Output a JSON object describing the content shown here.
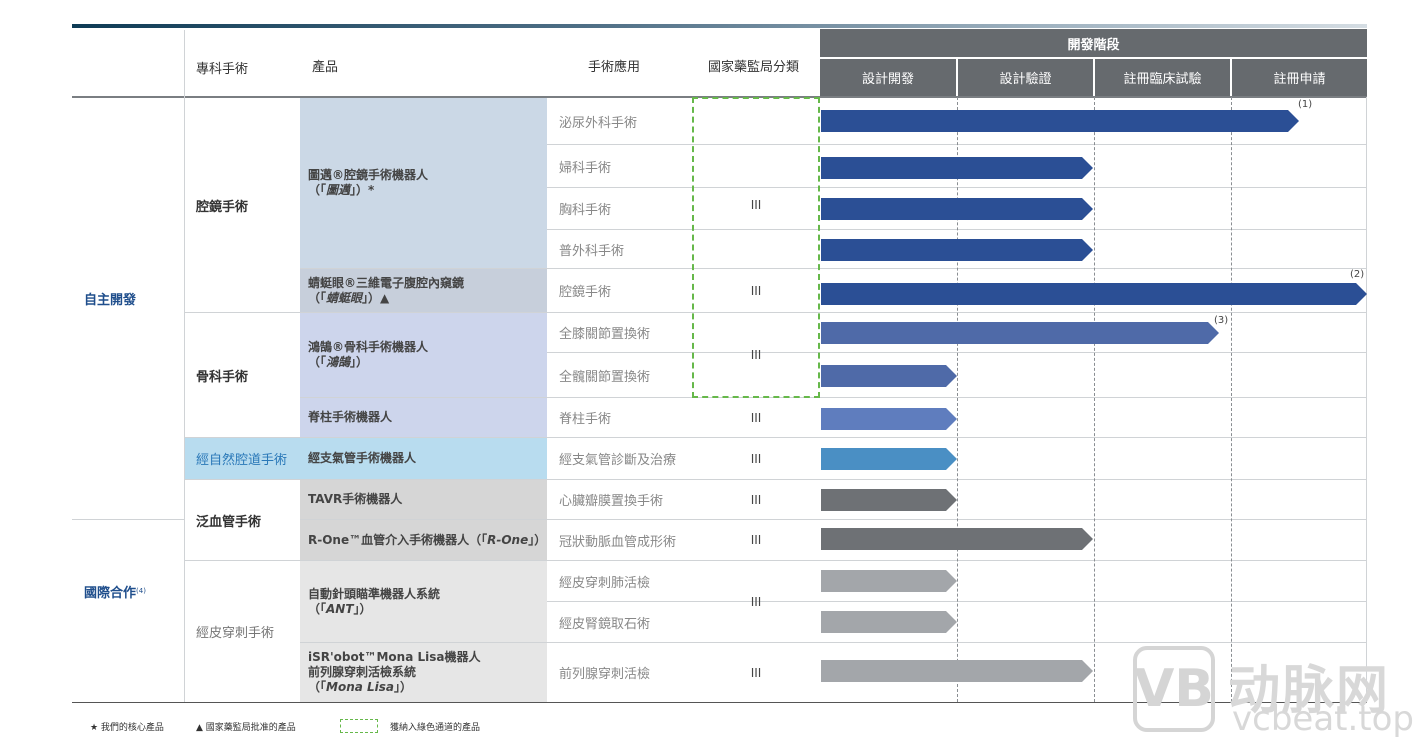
{
  "header": {
    "specialty": "專科手術",
    "product": "產品",
    "application": "手術應用",
    "nmpa_class": "國家藥監局分類",
    "phase_group": "開發階段",
    "phases": [
      "設計開發",
      "設計驗證",
      "註冊臨床試驗",
      "註冊申請"
    ]
  },
  "categories": {
    "self": "自主開發",
    "intl": "國際合作",
    "intl_note": "(4)"
  },
  "specialties": {
    "lap": "腔鏡手術",
    "ortho": "骨科手術",
    "notes": "經自然腔道手術",
    "vascular": "泛血管手術",
    "perc": "經皮穿刺手術"
  },
  "products": {
    "toumai_line1": "圖邁®腔鏡手術機器人",
    "toumai_line2_pre": "（「",
    "toumai_name": "圖邁",
    "toumai_line2_post": "」）*",
    "qingting_line1": "蜻蜓眼®三維電子腹腔內窺鏡",
    "qingting_line2_pre": "（「",
    "qingting_name": "蜻蜓眼",
    "qingting_line2_post": "」）▲",
    "honghu_line1": "鴻鵠®骨科手術機器人",
    "honghu_line2_pre": "（「",
    "honghu_name": "鴻鵠",
    "honghu_line2_post": "」）",
    "spine": "脊柱手術機器人",
    "bronch": "經支氣管手術機器人",
    "tavr": "TAVR手術機器人",
    "rone_pre": "R-One™血管介入手術機器人（「",
    "rone_name": "R-One",
    "rone_post": "」）",
    "ant_line1": "自動針頭瞄準機器人系統",
    "ant_line2_pre": "（「",
    "ant_name": "ANT",
    "ant_line2_post": "」）",
    "mona_line1": "iSR'obot™Mona Lisa機器人",
    "mona_line2": "前列腺穿刺活檢系統",
    "mona_line3_pre": "（「",
    "mona_name": "Mona Lisa",
    "mona_line3_post": "」）"
  },
  "applications": [
    "泌尿外科手術",
    "婦科手術",
    "胸科手術",
    "普外科手術",
    "腔鏡手術",
    "全膝關節置換術",
    "全髖關節置換術",
    "脊柱手術",
    "經支氣管診斷及治療",
    "心臟瓣膜置換手術",
    "冠狀動脈血管成形術",
    "經皮穿刺肺活檢",
    "經皮腎鏡取石術",
    "前列腺穿刺活檢"
  ],
  "nmpa_class_value": "III",
  "footnotes": [
    "(1)",
    "(2)",
    "(3)"
  ],
  "progress": [
    {
      "application": "泌尿外科手術",
      "phase": "註冊申請",
      "color": "#2b4f95"
    },
    {
      "application": "婦科手術",
      "phase": "設計驗證",
      "color": "#2b4f95"
    },
    {
      "application": "胸科手術",
      "phase": "設計驗證",
      "color": "#2b4f95"
    },
    {
      "application": "普外科手術",
      "phase": "設計驗證",
      "color": "#2b4f95"
    },
    {
      "application": "腔鏡手術",
      "phase": "註冊申請",
      "color": "#2b4f95"
    },
    {
      "application": "全膝關節置換術",
      "phase": "註冊申請",
      "color": "#4f6aa8"
    },
    {
      "application": "全髖關節置換術",
      "phase": "設計開發",
      "color": "#4f6aa8"
    },
    {
      "application": "脊柱手術",
      "phase": "設計開發",
      "color": "#5f7dbe"
    },
    {
      "application": "經支氣管診斷及治療",
      "phase": "設計開發",
      "color": "#4a8fc4"
    },
    {
      "application": "心臟瓣膜置換手術",
      "phase": "設計開發",
      "color": "#6e7175"
    },
    {
      "application": "冠狀動脈血管成形術",
      "phase": "設計驗證",
      "color": "#6e7175"
    },
    {
      "application": "經皮穿刺肺活檢",
      "phase": "設計開發",
      "color": "#a3a6aa"
    },
    {
      "application": "經皮腎鏡取石術",
      "phase": "設計開發",
      "color": "#a3a6aa"
    },
    {
      "application": "前列腺穿刺活檢",
      "phase": "設計驗證",
      "color": "#a3a6aa"
    }
  ],
  "legend": {
    "core": "★ 我們的核心產品",
    "approved": "▲ 國家藥監局批准的產品",
    "green": "獲納入綠色通道的產品"
  },
  "watermark": {
    "logo": "VB",
    "cn": "动脉网",
    "en": "vcbeat.top"
  }
}
